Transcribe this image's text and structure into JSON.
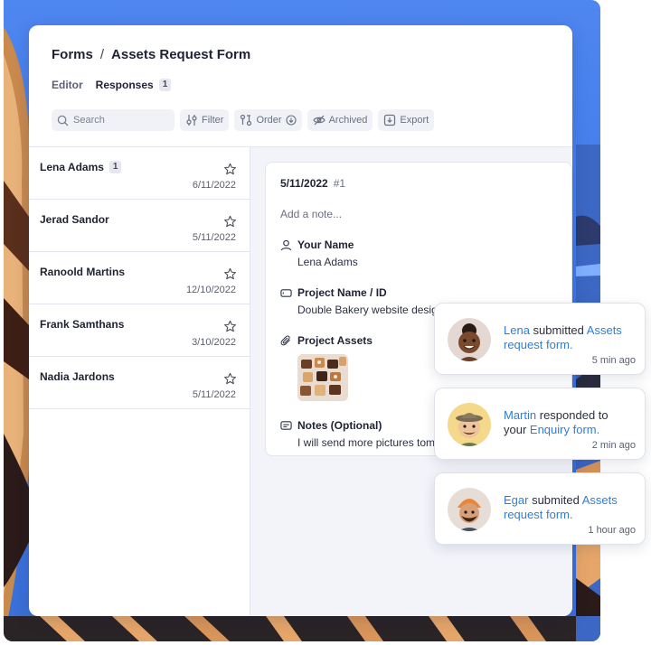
{
  "header": {
    "breadcrumb_root": "Forms",
    "breadcrumb_separator": "/",
    "title": "Assets Request Form"
  },
  "tabs": {
    "editor": "Editor",
    "responses": "Responses",
    "responses_count": "1"
  },
  "toolbar": {
    "search_placeholder": "Search",
    "filter": "Filter",
    "order": "Order",
    "archived": "Archived",
    "export": "Export"
  },
  "responses": [
    {
      "name": "Lena Adams",
      "badge": "1",
      "date": "6/11/2022"
    },
    {
      "name": "Jerad Sandor",
      "badge": "",
      "date": "5/11/2022"
    },
    {
      "name": "Ranoold Martins",
      "badge": "",
      "date": "12/10/2022"
    },
    {
      "name": "Frank Samthans",
      "badge": "",
      "date": "3/10/2022"
    },
    {
      "name": "Nadia Jardons",
      "badge": "",
      "date": "5/11/2022"
    }
  ],
  "detail": {
    "date": "5/11/2022",
    "number": "#1",
    "note_placeholder": "Add a note...",
    "your_name_label": "Your Name",
    "your_name_value": "Lena Adams",
    "project_name_label": "Project Name / ID",
    "project_name_value": "Double Bakery website design",
    "project_assets_label": "Project Assets",
    "notes_label": "Notes (Optional)",
    "notes_value": "I will send more pictures tomorrow"
  },
  "notifications": [
    {
      "actor": "Lena",
      "text": " submitted ",
      "link": "Assets request form.",
      "time": "5 min ago"
    },
    {
      "actor": "Martin",
      "text": " responded to your ",
      "link": "Enquiry form.",
      "time": "2 min ago"
    },
    {
      "actor": "Egar",
      "text": " submited ",
      "link": "Assets request form.",
      "time": "1 hour ago"
    }
  ],
  "colors": {
    "accent_link": "#2f7ed8",
    "backdrop_blue": "#4f86f0",
    "detail_bg": "#f3f4fa"
  }
}
